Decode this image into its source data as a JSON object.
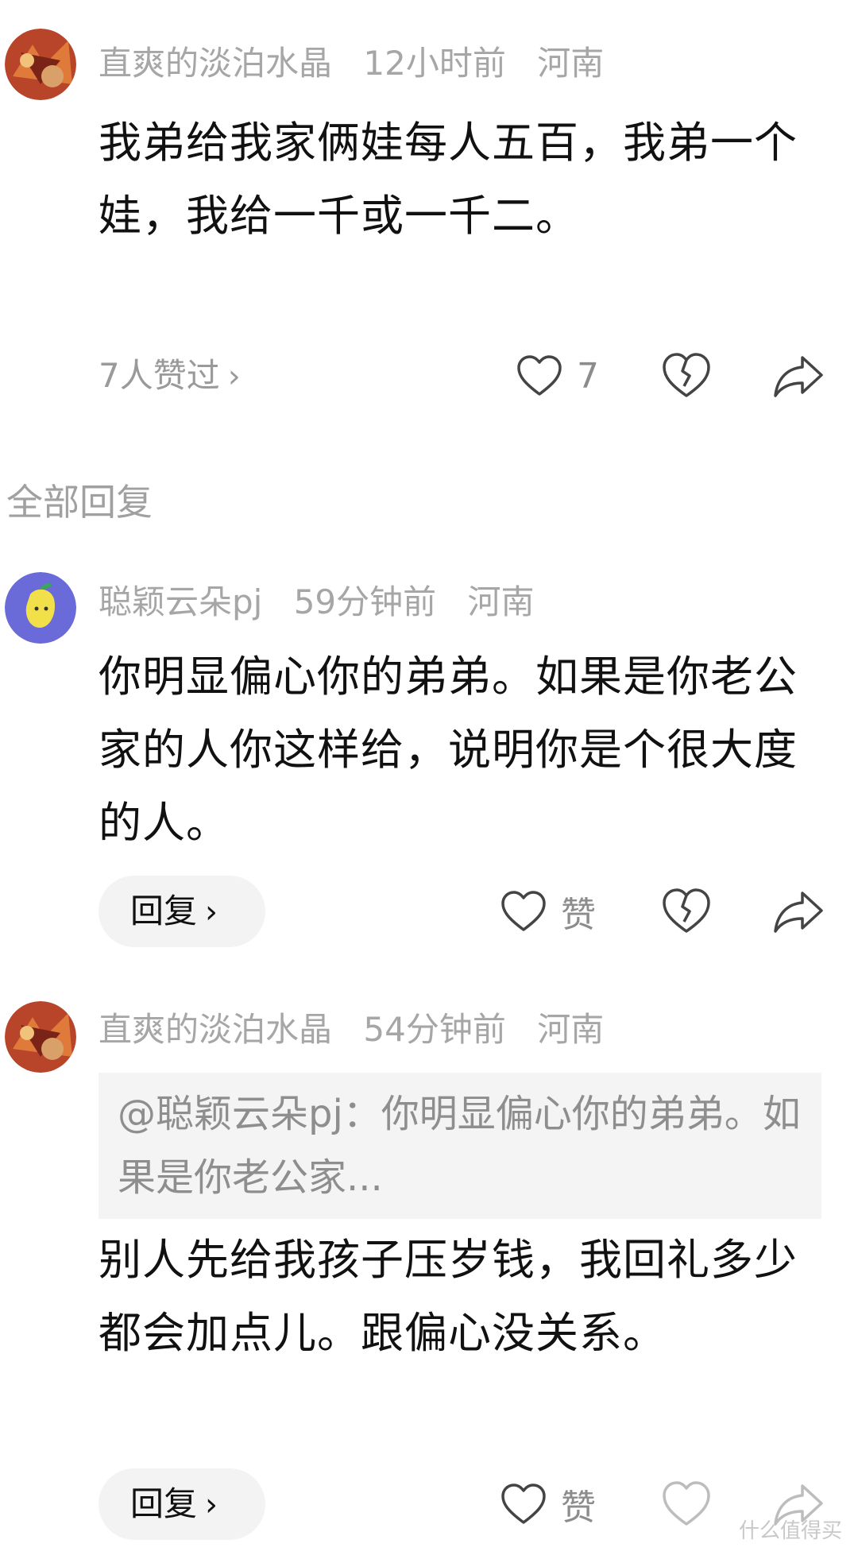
{
  "comments": [
    {
      "username": "直爽的淡泊水晶",
      "time": "12小时前",
      "location": "河南",
      "text": "我弟给我家俩娃每人五百，我弟一个娃，我给一千或一千二。",
      "liked_by": "7人赞过",
      "like_count": "7"
    },
    {
      "username": "聪颖云朵pj",
      "time": "59分钟前",
      "location": "河南",
      "text": "你明显偏心你的弟弟。如果是你老公家的人你这样给，说明你是个很大度的人。",
      "reply_label": "回复",
      "like_label": "赞"
    },
    {
      "username": "直爽的淡泊水晶",
      "time": "54分钟前",
      "location": "河南",
      "quote": "@聪颖云朵pj：你明显偏心你的弟弟。如果是你老公家...",
      "text": "别人先给我孩子压岁钱，我回礼多少都会加点儿。跟偏心没关系。",
      "reply_label": "回复",
      "like_label": "赞"
    }
  ],
  "section_label": "全部回复",
  "watermark": "什么值得买",
  "icons": {
    "like": "heart-outline-icon",
    "dislike": "broken-heart-icon",
    "share": "share-arrow-icon",
    "chevron": "chevron-right-icon"
  },
  "colors": {
    "meta_gray": "#a6a6a6",
    "reply_bg": "#f3f3f3",
    "quote_bg": "#f4f4f4"
  }
}
